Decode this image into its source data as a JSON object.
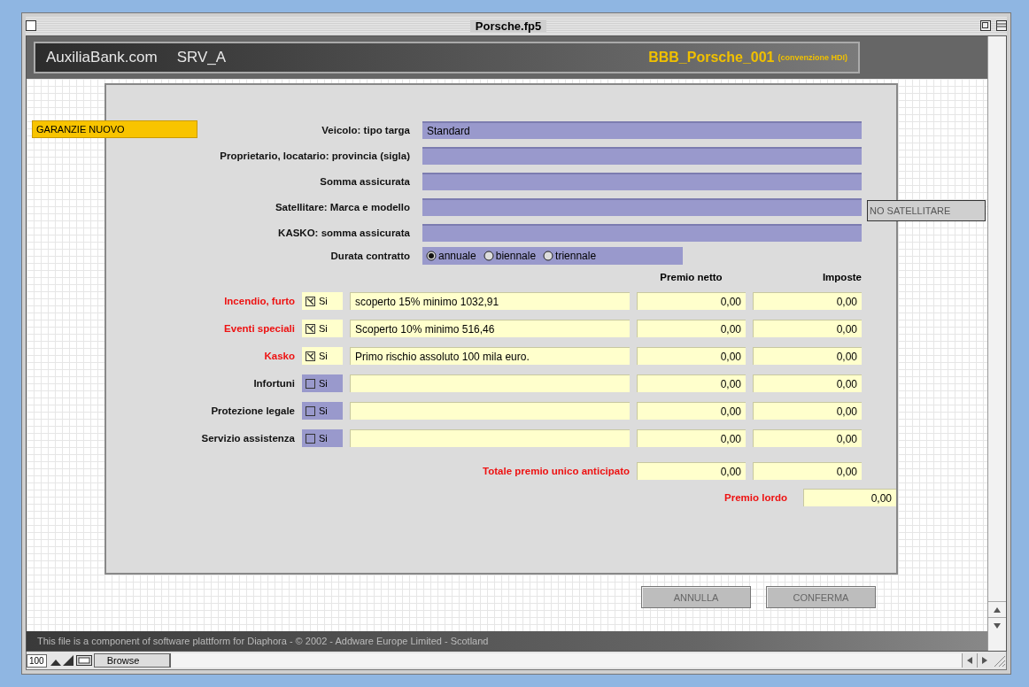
{
  "window": {
    "title": "Porsche.fp5"
  },
  "header": {
    "site": "AuxiliaBank.com",
    "server": "SRV_A",
    "file_id": "BBB_Porsche_001",
    "agreement": "(convenzione HDI)"
  },
  "section_tag": "GARANZIE NUOVO",
  "vehicle_fields": [
    {
      "label": "Veicolo: tipo targa",
      "value": "Standard"
    },
    {
      "label": "Proprietario, locatario: provincia (sigla)"
    },
    {
      "label": "Somma assicurata"
    },
    {
      "label": "Satellitare: Marca e modello"
    },
    {
      "label": "KASKO: somma assicurata"
    }
  ],
  "satellite_button": "NO SATELLITARE",
  "contract_duration": {
    "label": "Durata contratto",
    "options": [
      {
        "label": "annuale",
        "selected": true
      },
      {
        "label": "biennale",
        "selected": false
      },
      {
        "label": "triennale",
        "selected": false
      }
    ]
  },
  "coverage": {
    "columns": [
      "Premio netto",
      "Imposte"
    ],
    "rows": [
      {
        "label": "Incendio, furto",
        "checked": true,
        "check_label": "Si",
        "note": "scoperto 15% minimo 1032,91",
        "premio_netto": "0,00",
        "imposte": "0,00"
      },
      {
        "label": "Eventi speciali",
        "checked": true,
        "check_label": "Si",
        "note": "Scoperto 10% minimo 516,46",
        "premio_netto": "0,00",
        "imposte": "0,00"
      },
      {
        "label": "Kasko",
        "checked": true,
        "check_label": "Si",
        "note": "Primo rischio assoluto 100 mila euro.",
        "premio_netto": "0,00",
        "imposte": "0,00"
      },
      {
        "label": "Infortuni",
        "checked": false,
        "check_label": "Si",
        "premio_netto": "0,00",
        "imposte": "0,00"
      },
      {
        "label": "Protezione legale",
        "checked": false,
        "check_label": "Si",
        "premio_netto": "0,00",
        "imposte": "0,00"
      },
      {
        "label": "Servizio assistenza",
        "checked": false,
        "check_label": "Si",
        "premio_netto": "0,00",
        "imposte": "0,00"
      }
    ],
    "total": {
      "label": "Totale premio unico anticipato",
      "premio_netto": "0,00",
      "imposte": "0,00"
    },
    "gross": {
      "label": "Premio lordo",
      "value": "0,00"
    }
  },
  "buttons": [
    "ANNULLA",
    "CONFERMA"
  ],
  "footer": "This file is a component of software plattform for Diaphora - © 2002 - Addware Europe Limited - Scotland",
  "status_bar": {
    "zoom": "100",
    "mode": "Browse"
  }
}
